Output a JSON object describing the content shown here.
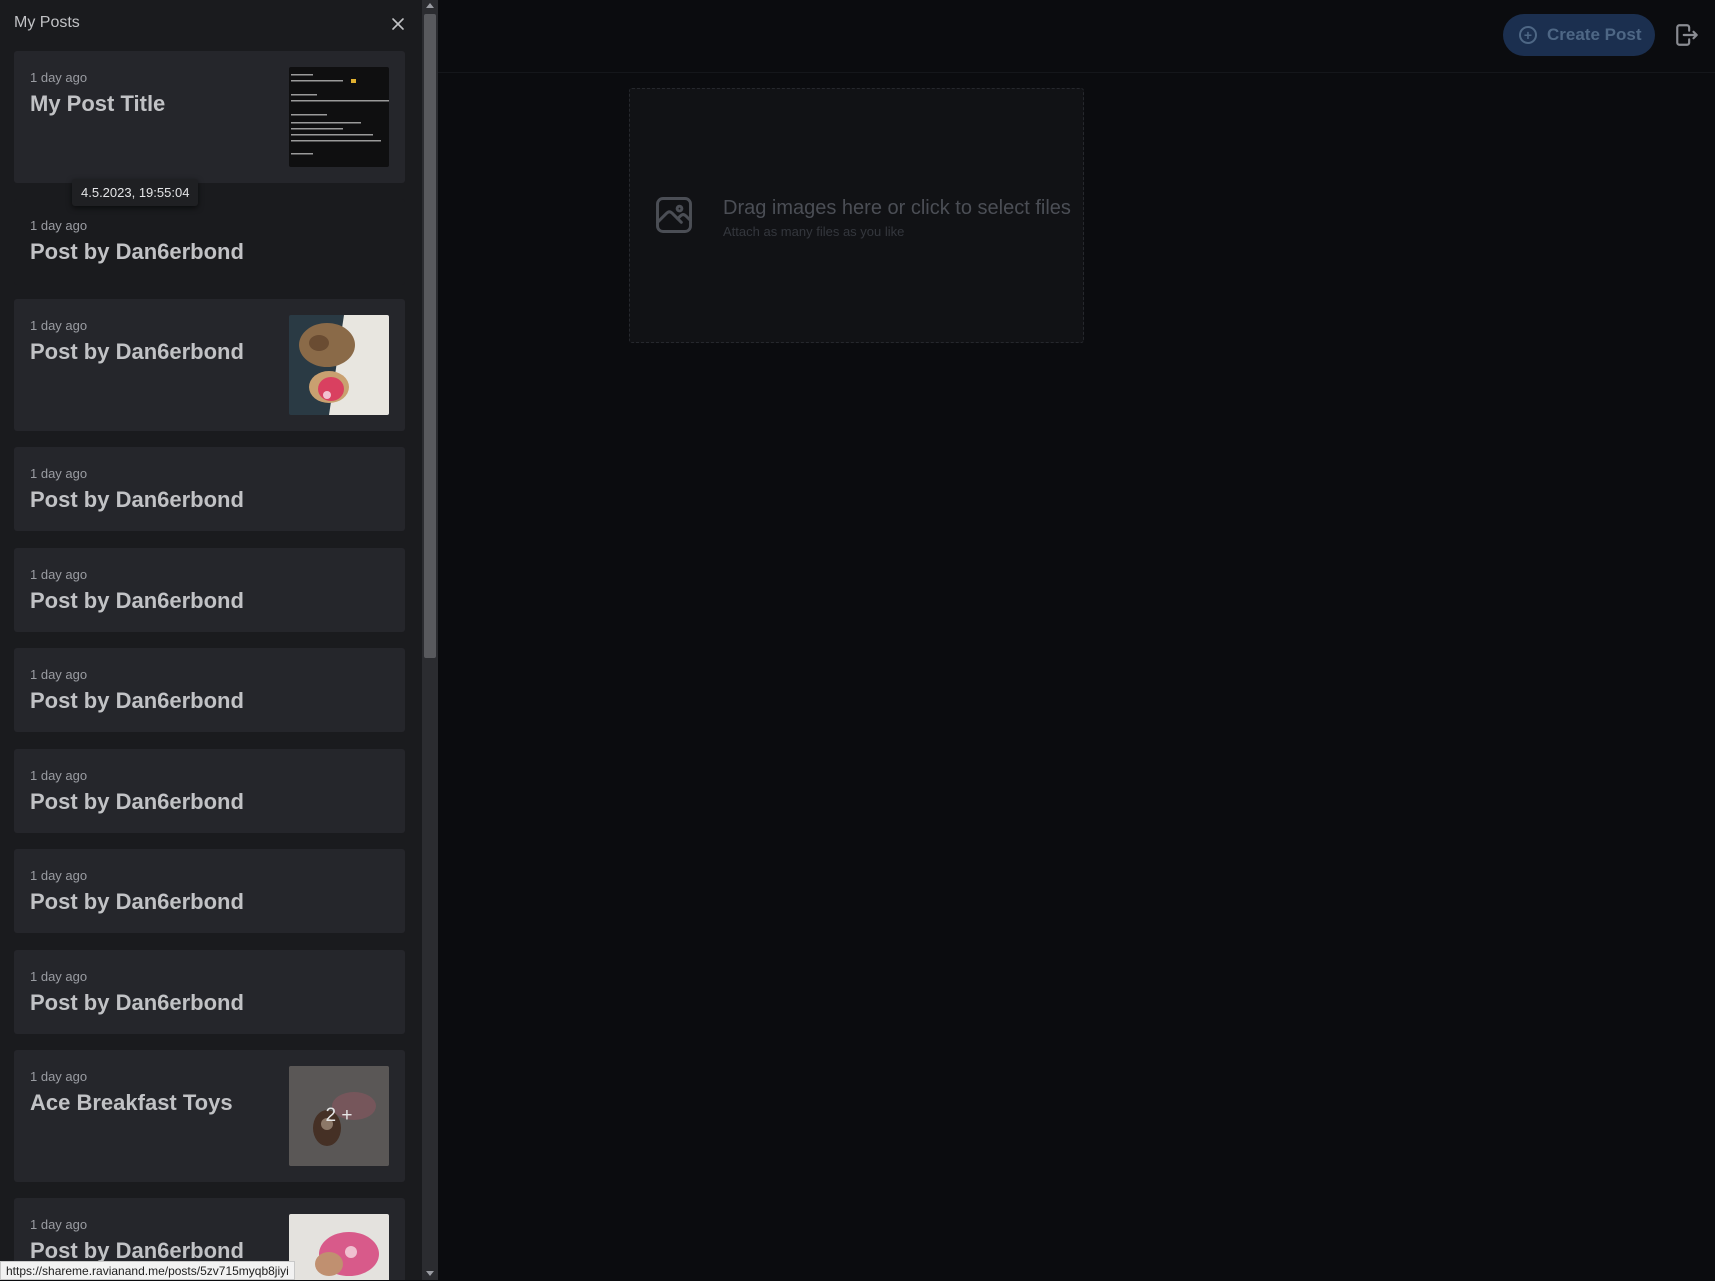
{
  "header": {
    "create_post_label": "Create Post",
    "create_post_icon": "plus-circle-icon",
    "logout_icon": "logout-icon",
    "accent_color": "#1b2f4f"
  },
  "dropzone": {
    "icon": "image-icon",
    "title": "Drag images here or click to select files",
    "subtitle": "Attach as many files as you like"
  },
  "drawer": {
    "title": "My Posts",
    "close_icon": "close-icon",
    "tooltip": "4.5.2023, 19:55:04",
    "posts": [
      {
        "time": "1 day ago",
        "title": "My Post Title",
        "thumbnail": "screenshot"
      },
      {
        "time": "1 day ago",
        "title": "Post by Dan6erbond",
        "thumbnail": "none"
      },
      {
        "time": "1 day ago",
        "title": "Post by Dan6erbond",
        "thumbnail": "dog-photo"
      },
      {
        "time": "1 day ago",
        "title": "Post by Dan6erbond",
        "thumbnail": "none"
      },
      {
        "time": "1 day ago",
        "title": "Post by Dan6erbond",
        "thumbnail": "none"
      },
      {
        "time": "1 day ago",
        "title": "Post by Dan6erbond",
        "thumbnail": "none"
      },
      {
        "time": "1 day ago",
        "title": "Post by Dan6erbond",
        "thumbnail": "none"
      },
      {
        "time": "1 day ago",
        "title": "Post by Dan6erbond",
        "thumbnail": "none"
      },
      {
        "time": "1 day ago",
        "title": "Post by Dan6erbond",
        "thumbnail": "none"
      },
      {
        "time": "1 day ago",
        "title": "Ace Breakfast Toys",
        "thumbnail": "toy-photo",
        "more_count": "2 +"
      },
      {
        "time": "1 day ago",
        "title": "Post by Dan6erbond",
        "thumbnail": "toy-photo"
      }
    ]
  },
  "status_url": "https://shareme.ravianand.me/posts/5zv715myqb8jiyi"
}
